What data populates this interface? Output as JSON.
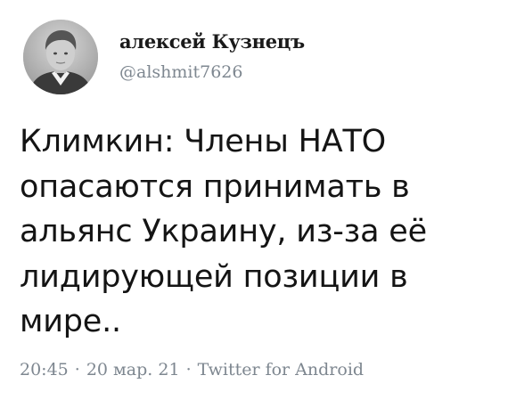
{
  "tweet": {
    "author": {
      "display_name": "алексей Кузнецъ",
      "handle": "@alshmit7626",
      "avatar": "avatar-photo-boy"
    },
    "text": "Климкин: Члены НАТО\nопасаются принимать в\nальянс Украину, из-за её\nлидирующей позиции в\nмире..",
    "meta": {
      "time": "20:45",
      "separator": "·",
      "date": "20 мар. 21",
      "source": "Twitter for Android"
    }
  },
  "colors": {
    "text": "#141414",
    "muted": "#7e8790",
    "background": "#ffffff"
  }
}
